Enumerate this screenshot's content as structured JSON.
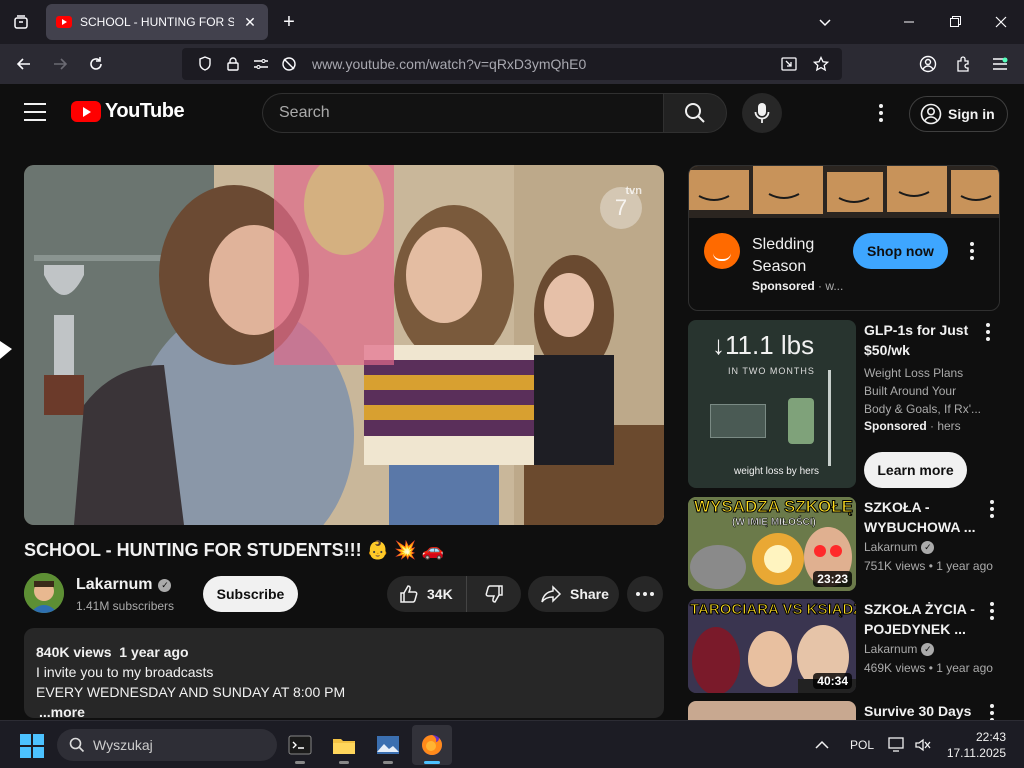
{
  "browser": {
    "tab_title": "SCHOOL - HUNTING FOR STUDENTS!!!",
    "tab_close": "✕",
    "new_tab": "+",
    "url_domain": "www.youtube.com",
    "url_path": "/watch?v=qRxD3ymQhE0"
  },
  "header": {
    "logo_text": "YouTube",
    "search_placeholder": "Search",
    "sign_in_label": "Sign in"
  },
  "video": {
    "title": "SCHOOL - HUNTING FOR STUDENTS!!! 👶 💥 🚗",
    "watermark": "7",
    "watermark_label": "tvn",
    "channel_name": "Lakarnum",
    "subscribers": "1.41M subscribers",
    "subscribe_label": "Subscribe",
    "likes": "34K",
    "share_label": "Share",
    "description": {
      "views": "840K views",
      "date": "1 year ago",
      "line1": "I invite you to my broadcasts",
      "line2": "EVERY WEDNESDAY AND SUNDAY AT 8:00 PM",
      "more": "...more"
    }
  },
  "ad": {
    "title": "Sledding Season",
    "sponsored": "Sponsored",
    "sponsor_suffix": " · w...",
    "cta": "Shop now"
  },
  "recommendations": [
    {
      "title": "GLP-1s for Just $50/wk",
      "desc": "Weight Loss Plans Built Around Your Body & Goals, If Rx'...",
      "sponsored": "Sponsored",
      "sponsor_name": " · hers",
      "cta": "Learn more",
      "thumb_big": "↓11.1 lbs",
      "thumb_sub": "IN TWO MONTHS",
      "thumb_brand": "weight loss by hers"
    },
    {
      "title": "SZKOŁA - WYBUCHOWA ...",
      "channel": "Lakarnum",
      "meta": "751K views • 1 year ago",
      "duration": "23:23",
      "thumb_text": "WYSADZA SZKOŁĘ",
      "thumb_sub": "(W IMIĘ MIŁOŚCI)"
    },
    {
      "title": "SZKOŁA ŻYCIA - POJEDYNEK ...",
      "channel": "Lakarnum",
      "meta": "469K views • 1 year ago",
      "duration": "40:34",
      "thumb_text": "TAROCIARA VS KSIĄDZ"
    },
    {
      "title": "Survive 30 Days"
    }
  ],
  "taskbar": {
    "search_placeholder": "Wyszukaj",
    "lang": "POL",
    "time": "22:43",
    "date": "17.11.2025"
  }
}
